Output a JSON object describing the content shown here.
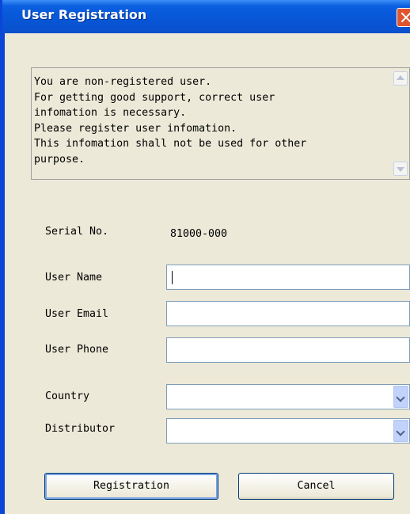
{
  "window": {
    "title": "User Registration"
  },
  "notice": {
    "text": "You are non-registered user.\nFor getting good support, correct user\ninfomation is necessary.\nPlease register user infomation.\nThis infomation shall not be used for other\npurpose."
  },
  "form": {
    "serial_label": "Serial No.",
    "serial_value": "81000-000",
    "name_label": "User Name",
    "name_value": "",
    "email_label": "User Email",
    "email_value": "",
    "phone_label": "User Phone",
    "phone_value": "",
    "country_label": "Country",
    "country_value": "",
    "distributor_label": "Distributor",
    "distributor_value": ""
  },
  "buttons": {
    "registration": "Registration",
    "cancel": "Cancel"
  },
  "colors": {
    "titlebar": "#0a5fe0",
    "close": "#e0542e",
    "dialog_bg": "#ece9d8"
  },
  "icons": {
    "close": "close-icon",
    "scroll_up": "scroll-up-arrow-icon",
    "scroll_down": "scroll-down-arrow-icon",
    "dropdown": "chevron-down-icon"
  }
}
